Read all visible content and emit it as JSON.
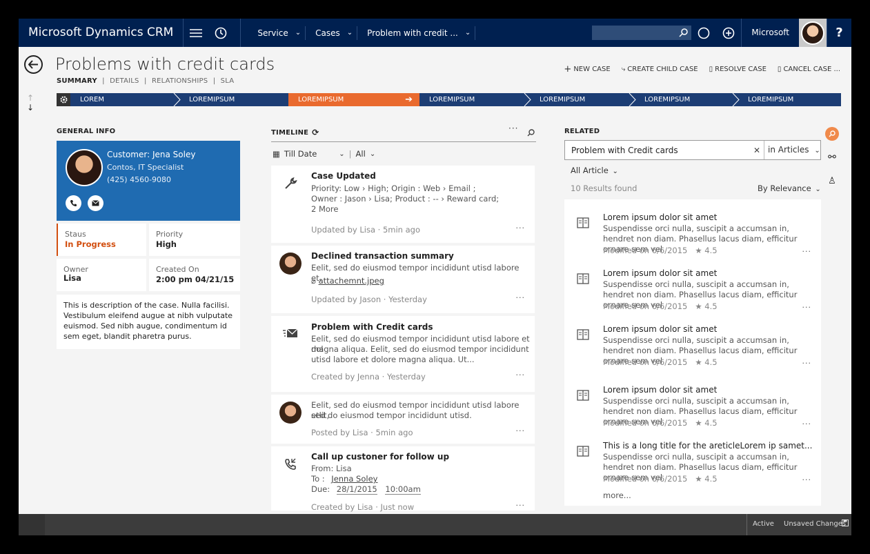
{
  "nav": {
    "brand": "Microsoft Dynamics CRM",
    "breadcrumbs": [
      "Service",
      "Cases",
      "Problem with credit ..."
    ],
    "org": "Microsoft",
    "help": "?"
  },
  "header": {
    "title": "Problems with credit cards",
    "subtabs": [
      "SUMMARY",
      "DETAILS",
      "RELATIONSHIPS",
      "SLA"
    ],
    "actions": [
      "NEW CASE",
      "CREATE CHILD CASE",
      "RESOLVE CASE",
      "CANCEL CASE ..."
    ]
  },
  "process": {
    "stages": [
      "LOREM",
      "LOREMIPSUM",
      "LOREMIPSUM",
      "LOREMIPSUM",
      "LOREMIPSUM",
      "LOREMIPSUM",
      "LOREMIPSUM"
    ],
    "active_index": 2
  },
  "general": {
    "section_title": "GENERAL INFO",
    "customer_label": "Customer:",
    "customer_name": "Jena Soley",
    "company": "Contos, IT Specialist",
    "phone": "(425) 4560-9080",
    "status_label": "Staus",
    "status_value": "In Progress",
    "priority_label": "Priority",
    "priority_value": "High",
    "owner_label": "Owner",
    "owner_value": "Lisa",
    "created_label": "Created On",
    "created_value": "2:00 pm 04/21/15",
    "description": "This is description of the case. Nulla facilisi. Vestibulum eleifend augue at nibh vulputate euismod. Sed nibh augue, condimentum id sem eget, blandit pharetra purus."
  },
  "timeline": {
    "section_title": "TIMELINE",
    "filter_date": "Till Date",
    "filter_all": "All",
    "items": [
      {
        "title": "Case Updated",
        "line1": "Priority: Low › High;  Origin : Web › Email ;",
        "line2": "Owner : Jason › Lisa;  Product : -- › Reward card;",
        "line3": "2 More",
        "footer": "Updated by Lisa  ·  5min ago"
      },
      {
        "title": "Declined transaction summary",
        "line1": "Eelit, sed do eiusmod tempor incididunt utisd labore et.",
        "attachment": "attachemnt.jpeg",
        "footer": "Updated by Jason  ·  Yesterday"
      },
      {
        "title": "Problem with Credit cards",
        "line1": "Eelit, sed do eiusmod tempor incididunt utisd labore et dol",
        "line2": "magna aliqua. Eelit, sed do eiusmod tempor incididunt",
        "line3": "utisd labore et dolore magna aliqua. Ut...",
        "footer": "Created by Jenna  ·  Yesterday"
      },
      {
        "line1": "Eelit, sed do eiusmod tempor incididunt utisd labore etlit,",
        "line2": "sed do eiusmod tempor incididunt utisd.",
        "footer": "Posted by Lisa  ·  5min ago"
      },
      {
        "title": "Call up custoner for follow up",
        "from": "From: Lisa",
        "to_label": "To :",
        "to_value": "Jenna Soley",
        "due_label": "Due:",
        "due_date": "28/1/2015",
        "due_time": "10:00am",
        "footer": "Created by Lisa  ·  Just now"
      }
    ],
    "more": "···"
  },
  "related": {
    "section_title": "RELATED",
    "search_value": "Problem with Credit cards",
    "search_scope": "in Articles",
    "filter": "All Article",
    "count": "10 Results found",
    "sort": "By Relevance",
    "articles": [
      {
        "title": "Lorem ipsum dolor sit amet",
        "body": "Suspendisse orci nulla, suscipit a accumsan in, hendret non diam. Phasellus lacus diam, efficitur ornare sem vel",
        "modified": "Modified on 6/6/2015",
        "rating": "★ 4.5"
      },
      {
        "title": "Lorem ipsum dolor sit amet",
        "body": "Suspendisse orci nulla, suscipit a accumsan in, hendret non diam. Phasellus lacus diam, efficitur ornare sem vel",
        "modified": "Modified on 6/6/2015",
        "rating": "★ 4.5"
      },
      {
        "title": "Lorem ipsum dolor sit amet",
        "body": "Suspendisse orci nulla, suscipit a accumsan in, hendret non diam. Phasellus lacus diam, efficitur ornare sem vel",
        "modified": "Modified on 6/6/2015",
        "rating": "★ 4.5"
      },
      {
        "title": "Lorem ipsum dolor sit amet",
        "body": "Suspendisse orci nulla, suscipit a accumsan in, hendret non diam. Phasellus lacus diam, efficitur ornare sem vel",
        "modified": "Modified on 6/6/2015",
        "rating": "★ 4.5"
      },
      {
        "title": "This is a long title for the areticleLorem ip samet...",
        "body": "Suspendisse orci nulla, suscipit a accumsan in, hendret non diam. Phasellus lacus diam, efficitur ornare sem vel",
        "modified": "Modified on 6/6/2015",
        "rating": "★ 4.5"
      }
    ],
    "more_link": "more..."
  },
  "status": {
    "state": "Active",
    "unsaved": "Unsaved Changes"
  },
  "colors": {
    "nav_bg": "#002050",
    "process_bg": "#1c3d74",
    "process_active": "#e96a2e",
    "customer_card": "#1f6bb1",
    "status_orange": "#d24e0f"
  }
}
